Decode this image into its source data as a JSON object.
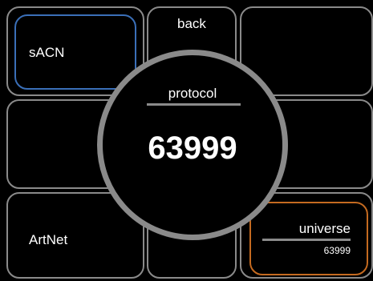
{
  "tiles": {
    "sacn": {
      "label": "sACN"
    },
    "back": {
      "label": "back"
    },
    "artnet": {
      "label": "ArtNet"
    }
  },
  "dial": {
    "title": "protocol",
    "value": "63999"
  },
  "universe": {
    "title": "universe",
    "value": "63999"
  },
  "colors": {
    "background": "#000000",
    "tile_border": "#8a8a8a",
    "selected_accent": "#3a6fb8",
    "universe_accent": "#c46a20",
    "text": "#ffffff"
  }
}
